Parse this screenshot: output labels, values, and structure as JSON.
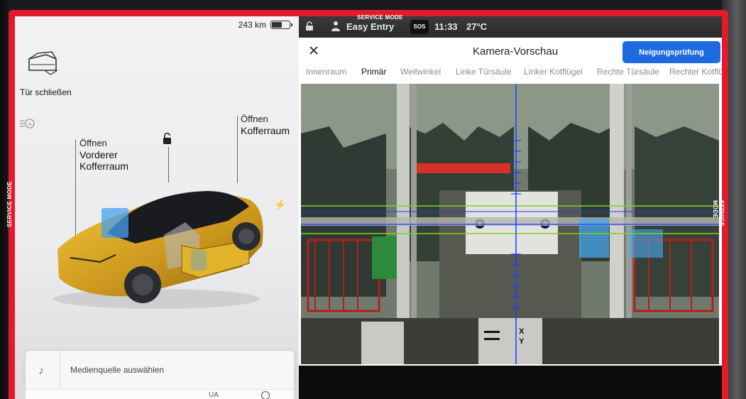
{
  "frame": {
    "label": "SERVICE MODE"
  },
  "left_panel": {
    "battery": {
      "range": "243 km"
    },
    "close_door_label": "Tür schließen",
    "frunk": {
      "action": "Öffnen",
      "name_line1": "Vorderer",
      "name_line2": "Kofferraum"
    },
    "trunk": {
      "action": "Öffnen",
      "name": "Kofferraum"
    },
    "media": {
      "label": "Medienquelle auswählen",
      "mini": "UA"
    }
  },
  "status_bar": {
    "profile": "Easy Entry",
    "sos": "SOS",
    "time": "11:33",
    "temperature": "27°C"
  },
  "camera_preview": {
    "title": "Kamera-Vorschau",
    "tilt_check_button": "Neigungsprüfung",
    "tabs": [
      {
        "label": "Innenraum"
      },
      {
        "label": "Primär"
      },
      {
        "label": "Weitwinkel"
      },
      {
        "label": "Linke Türsäule"
      },
      {
        "label": "Linker Kotflügel"
      },
      {
        "label": "Rechte Türsäule"
      },
      {
        "label": "Rechter Kotflü"
      }
    ],
    "active_tab": "Primär",
    "target_letters": {
      "x": "X",
      "y": "Y"
    }
  },
  "colors": {
    "service_red": "#e21b2c",
    "accent_blue": "#1e6ae0",
    "car_yellow": "#e3b126",
    "guide_green": "#7ed321",
    "crosshair_blue": "#1f3cff"
  }
}
